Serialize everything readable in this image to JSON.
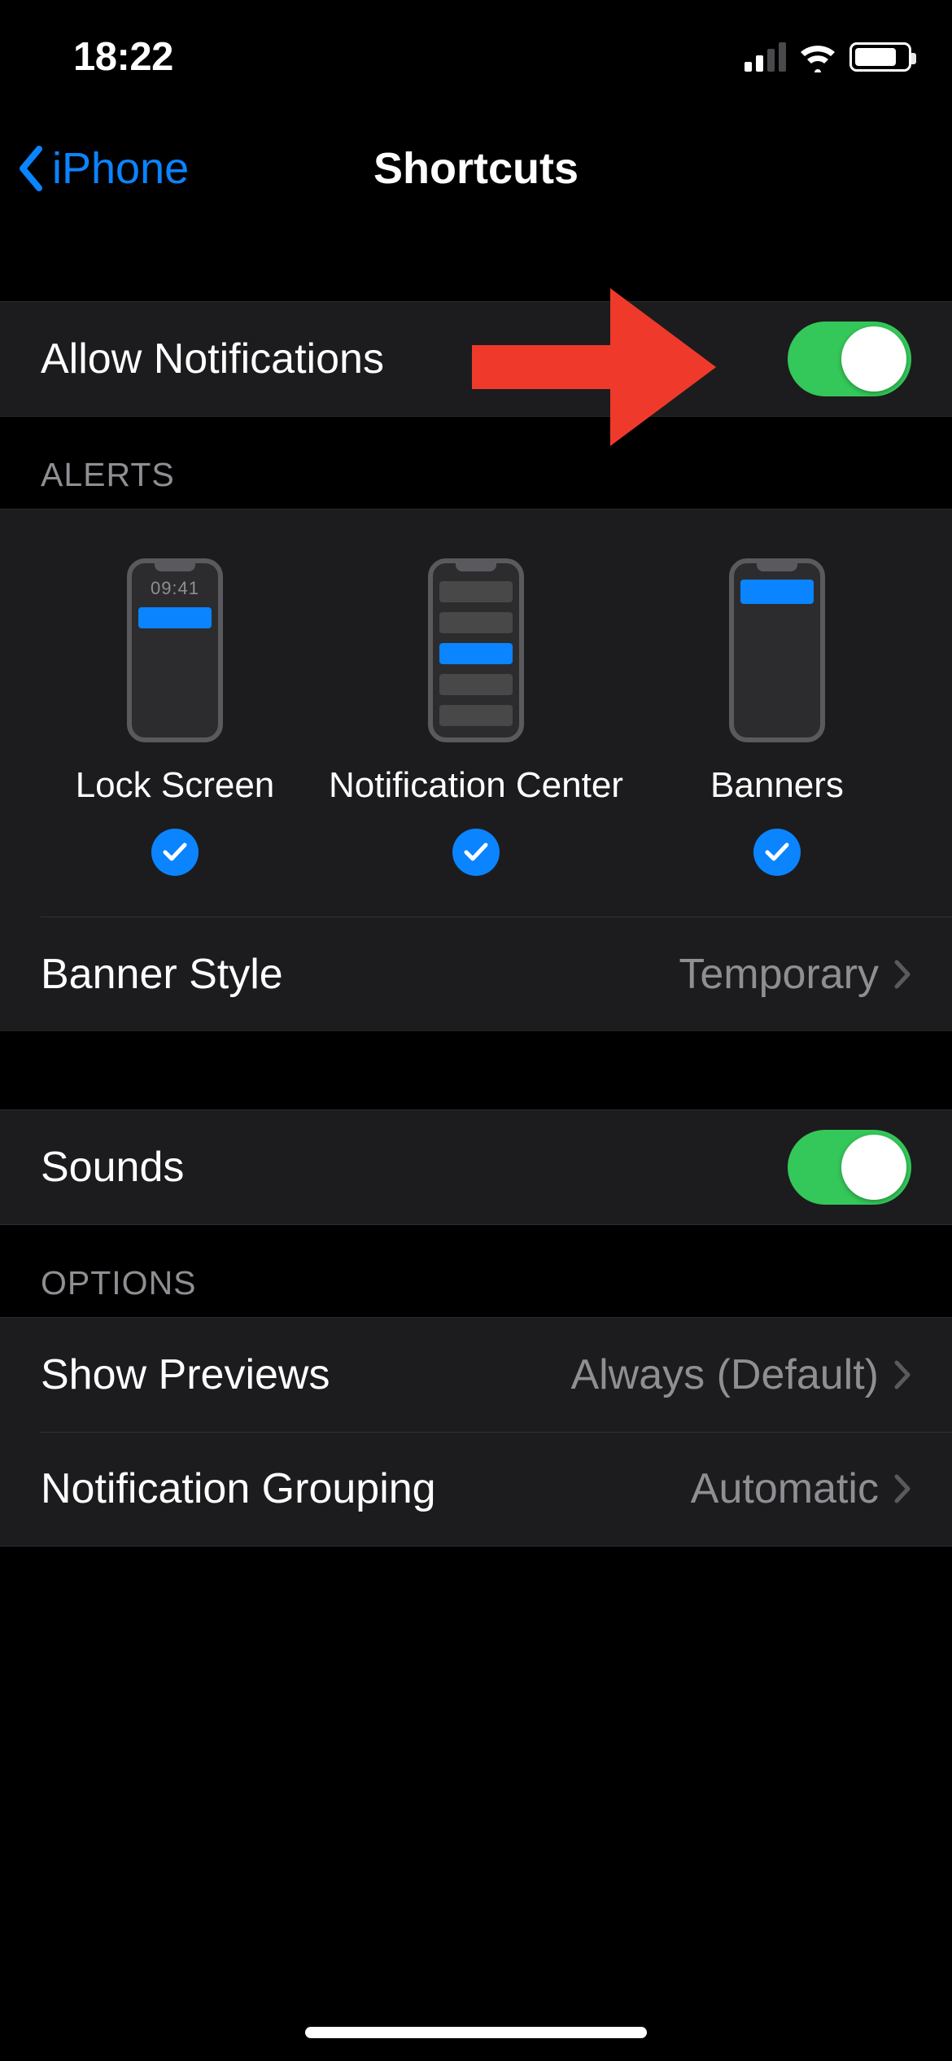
{
  "status": {
    "time": "18:22"
  },
  "nav": {
    "back_label": "iPhone",
    "title": "Shortcuts"
  },
  "allow": {
    "label": "Allow Notifications",
    "on": true
  },
  "alerts_header": "ALERTS",
  "alerts": {
    "lock_screen": {
      "label": "Lock Screen",
      "checked": true,
      "preview_time": "09:41"
    },
    "notification_center": {
      "label": "Notification Center",
      "checked": true
    },
    "banners": {
      "label": "Banners",
      "checked": true
    }
  },
  "banner_style": {
    "label": "Banner Style",
    "value": "Temporary"
  },
  "sounds": {
    "label": "Sounds",
    "on": true
  },
  "options_header": "OPTIONS",
  "show_previews": {
    "label": "Show Previews",
    "value": "Always (Default)"
  },
  "grouping": {
    "label": "Notification Grouping",
    "value": "Automatic"
  }
}
